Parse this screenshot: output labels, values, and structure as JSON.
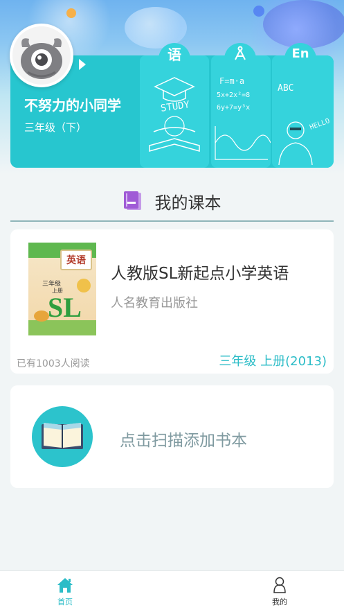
{
  "header": {
    "username": "不努力的小同学",
    "grade": "三年级（下）",
    "subjects": [
      {
        "tab_glyph": "语",
        "icon": "chinese-tab"
      },
      {
        "tab_glyph": "∆",
        "icon": "math-compass-tab"
      },
      {
        "tab_glyph": "En",
        "icon": "english-tab"
      }
    ],
    "deco": {
      "study": "STUDY",
      "formula1": "F=m·a",
      "formula2": "5x+2x²=8",
      "formula3": "6y+7=y³x",
      "abc": "ABC",
      "hello": "HELLO"
    }
  },
  "section": {
    "title": "我的课本"
  },
  "book": {
    "title": "人教版SL新起点小学英语",
    "publisher": "人名教育出版社",
    "readers": "已有1003人阅读",
    "grade_volume": "三年级 上册(2013)",
    "cover": {
      "subject": "英语",
      "grade": "三年级",
      "volume": "上册",
      "logo": "SL"
    }
  },
  "add_card": {
    "label": "点击扫描添加书本"
  },
  "tabbar": {
    "home_label": "首页",
    "mine_label": "我的"
  },
  "colors": {
    "accent": "#2bbcc7",
    "card_teal": "#27c6cf",
    "purple_icon": "#a05bd6"
  }
}
